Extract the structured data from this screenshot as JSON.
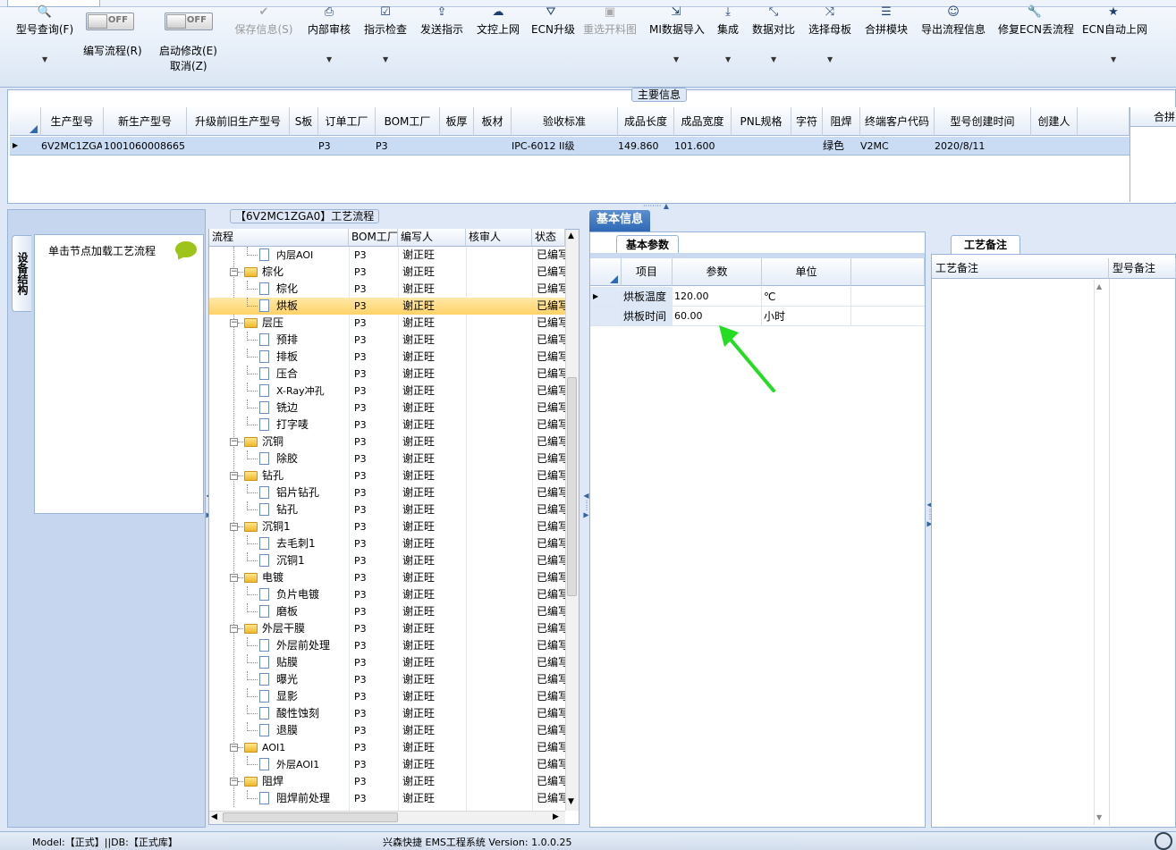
{
  "toolbar": {
    "buttons": [
      {
        "label": "型号查询(F)",
        "icon": "search-icon",
        "enabled": true
      },
      {
        "label": "保存信息(S)",
        "icon": "check-icon",
        "enabled": false
      },
      {
        "label": "内部审核",
        "icon": "printer-icon",
        "enabled": true
      },
      {
        "label": "指示检查",
        "icon": "checkbox-icon",
        "enabled": true
      },
      {
        "label": "发送指示",
        "icon": "upload-icon",
        "enabled": true
      },
      {
        "label": "文控上网",
        "icon": "cloud-upload-icon",
        "enabled": true
      },
      {
        "label": "ECN升级",
        "icon": "road-icon",
        "enabled": true
      },
      {
        "label": "重选开料图",
        "icon": "image-icon",
        "enabled": false
      },
      {
        "label": "MI数据导入",
        "icon": "import-icon",
        "enabled": true
      },
      {
        "label": "集成",
        "icon": "download-icon",
        "enabled": true
      },
      {
        "label": "数据对比",
        "icon": "compress-icon",
        "enabled": true
      },
      {
        "label": "选择母板",
        "icon": "shuffle-icon",
        "enabled": true
      },
      {
        "label": "合拼模块",
        "icon": "list-icon",
        "enabled": true
      },
      {
        "label": "导出流程信息",
        "icon": "smile-icon",
        "enabled": true
      },
      {
        "label": "修复ECN丢流程",
        "icon": "wrench-icon",
        "enabled": true
      },
      {
        "label": "ECN自动上网",
        "icon": "star-icon",
        "enabled": true
      }
    ],
    "toggle_state": "OFF",
    "edit_flow_label": "编写流程(R)",
    "start_modify_label": "启动修改(E)",
    "cancel_label": "取消(Z)"
  },
  "main_info": {
    "title": "主要信息",
    "columns": [
      "生产型号",
      "新生产型号",
      "升级前旧生产型号",
      "S板",
      "订单工厂",
      "BOM工厂",
      "板厚",
      "板材",
      "验收标准",
      "成品长度",
      "成品宽度",
      "PNL规格",
      "字符",
      "阻焊",
      "终端客户代码",
      "型号创建时间",
      "创建人"
    ],
    "row": [
      "6V2MC1ZGA0",
      "10010600086650",
      "",
      "",
      "P3",
      "P3",
      "",
      "",
      "IPC-6012 II级",
      "149.860",
      "101.600",
      "",
      "",
      "绿色",
      "V2MC",
      "2020/8/11",
      ""
    ],
    "right_header": "合拼"
  },
  "left_panel": {
    "vertical_tab": "设备结构",
    "node_hint": "单击节点加载工艺流程"
  },
  "flow": {
    "title": "【6V2MC1ZGA0】工艺流程",
    "columns": [
      "流程",
      "BOM工厂",
      "编写人",
      "核审人",
      "状态"
    ],
    "rows": [
      {
        "name": "内层AOI",
        "level": 1,
        "factory": "P3",
        "writer": "谢正旺",
        "status": "已编写"
      },
      {
        "name": "棕化",
        "level": 0,
        "factory": "P3",
        "writer": "谢正旺",
        "status": "已编写"
      },
      {
        "name": "棕化",
        "level": 1,
        "factory": "P3",
        "writer": "谢正旺",
        "status": "已编写"
      },
      {
        "name": "烘板",
        "level": 1,
        "factory": "P3",
        "writer": "谢正旺",
        "status": "已编写",
        "selected": true
      },
      {
        "name": "层压",
        "level": 0,
        "factory": "P3",
        "writer": "谢正旺",
        "status": "已编写"
      },
      {
        "name": "预排",
        "level": 1,
        "factory": "P3",
        "writer": "谢正旺",
        "status": "已编写"
      },
      {
        "name": "排板",
        "level": 1,
        "factory": "P3",
        "writer": "谢正旺",
        "status": "已编写"
      },
      {
        "name": "压合",
        "level": 1,
        "factory": "P3",
        "writer": "谢正旺",
        "status": "已编写"
      },
      {
        "name": "X-Ray冲孔",
        "level": 1,
        "factory": "P3",
        "writer": "谢正旺",
        "status": "已编写"
      },
      {
        "name": "铣边",
        "level": 1,
        "factory": "P3",
        "writer": "谢正旺",
        "status": "已编写"
      },
      {
        "name": "打字唛",
        "level": 1,
        "factory": "P3",
        "writer": "谢正旺",
        "status": "已编写"
      },
      {
        "name": "沉铜",
        "level": 0,
        "factory": "P3",
        "writer": "谢正旺",
        "status": "已编写"
      },
      {
        "name": "除胶",
        "level": 1,
        "factory": "P3",
        "writer": "谢正旺",
        "status": "已编写"
      },
      {
        "name": "钻孔",
        "level": 0,
        "factory": "P3",
        "writer": "谢正旺",
        "status": "已编写"
      },
      {
        "name": "铝片钻孔",
        "level": 1,
        "factory": "P3",
        "writer": "谢正旺",
        "status": "已编写"
      },
      {
        "name": "钻孔",
        "level": 1,
        "factory": "P3",
        "writer": "谢正旺",
        "status": "已编写"
      },
      {
        "name": "沉铜1",
        "level": 0,
        "factory": "P3",
        "writer": "谢正旺",
        "status": "已编写"
      },
      {
        "name": "去毛刺1",
        "level": 1,
        "factory": "P3",
        "writer": "谢正旺",
        "status": "已编写"
      },
      {
        "name": "沉铜1",
        "level": 1,
        "factory": "P3",
        "writer": "谢正旺",
        "status": "已编写"
      },
      {
        "name": "电镀",
        "level": 0,
        "factory": "P3",
        "writer": "谢正旺",
        "status": "已编写"
      },
      {
        "name": "负片电镀",
        "level": 1,
        "factory": "P3",
        "writer": "谢正旺",
        "status": "已编写"
      },
      {
        "name": "磨板",
        "level": 1,
        "factory": "P3",
        "writer": "谢正旺",
        "status": "已编写"
      },
      {
        "name": "外层干膜",
        "level": 0,
        "factory": "P3",
        "writer": "谢正旺",
        "status": "已编写"
      },
      {
        "name": "外层前处理",
        "level": 1,
        "factory": "P3",
        "writer": "谢正旺",
        "status": "已编写"
      },
      {
        "name": "贴膜",
        "level": 1,
        "factory": "P3",
        "writer": "谢正旺",
        "status": "已编写"
      },
      {
        "name": "曝光",
        "level": 1,
        "factory": "P3",
        "writer": "谢正旺",
        "status": "已编写"
      },
      {
        "name": "显影",
        "level": 1,
        "factory": "P3",
        "writer": "谢正旺",
        "status": "已编写"
      },
      {
        "name": "酸性蚀刻",
        "level": 1,
        "factory": "P3",
        "writer": "谢正旺",
        "status": "已编写"
      },
      {
        "name": "退膜",
        "level": 1,
        "factory": "P3",
        "writer": "谢正旺",
        "status": "已编写"
      },
      {
        "name": "AOI1",
        "level": 0,
        "factory": "P3",
        "writer": "谢正旺",
        "status": "已编写"
      },
      {
        "name": "外层AOI1",
        "level": 1,
        "factory": "P3",
        "writer": "谢正旺",
        "status": "已编写"
      },
      {
        "name": "阻焊",
        "level": 0,
        "factory": "P3",
        "writer": "谢正旺",
        "status": "已编写"
      },
      {
        "name": "阻焊前处理",
        "level": 1,
        "factory": "P3",
        "writer": "谢正旺",
        "status": "已编写"
      }
    ]
  },
  "basic_info": {
    "tab": "基本信息",
    "sub_tab": "基本参数",
    "columns": [
      "项目",
      "参数",
      "单位"
    ],
    "rows": [
      {
        "item": "烘板温度",
        "value": "120.00",
        "unit": "℃"
      },
      {
        "item": "烘板时间",
        "value": "60.00",
        "unit": "小时"
      }
    ]
  },
  "craft_note": {
    "tab": "工艺备注",
    "columns": [
      "工艺备注",
      "型号备注"
    ]
  },
  "status_bar": {
    "left": "Model:【正式】||DB:【正式库】",
    "center": "兴森快捷 EMS工程系统 Version: 1.0.0.25"
  },
  "colors": {
    "accent": "#2f68b5",
    "selected_row": "#c9dcf3",
    "tree_selected": "#ffd266",
    "arrow": "#22dd22"
  }
}
